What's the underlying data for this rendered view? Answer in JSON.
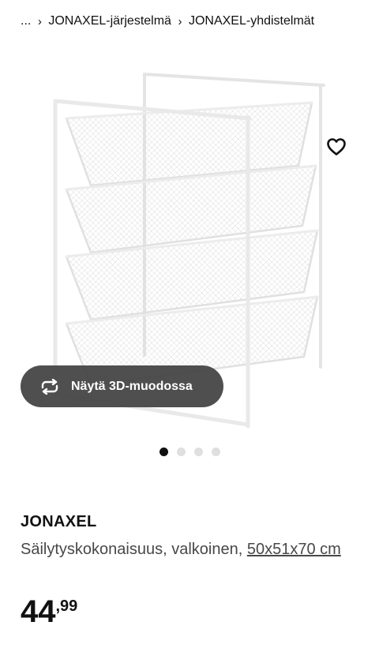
{
  "breadcrumb": {
    "ellipsis": "...",
    "separator": "›",
    "items": [
      "JONAXEL-järjestelmä",
      "JONAXEL-yhdistelmät"
    ]
  },
  "gallery": {
    "favorite_icon": "heart-icon",
    "view_3d_icon": "rotate-icon",
    "view_3d_label": "Näytä 3D-muodossa",
    "slide_count": 4,
    "active_slide": 1
  },
  "product": {
    "name": "JONAXEL",
    "description": "Säilytyskokonaisuus, valkoinen,",
    "size": "50x51x70 cm",
    "price_integer": "44",
    "price_decimal": ",99"
  },
  "colors": {
    "text": "#111111",
    "secondary_text": "#484848",
    "button_bg": "#484848",
    "dot_inactive": "#dfdfdf"
  }
}
